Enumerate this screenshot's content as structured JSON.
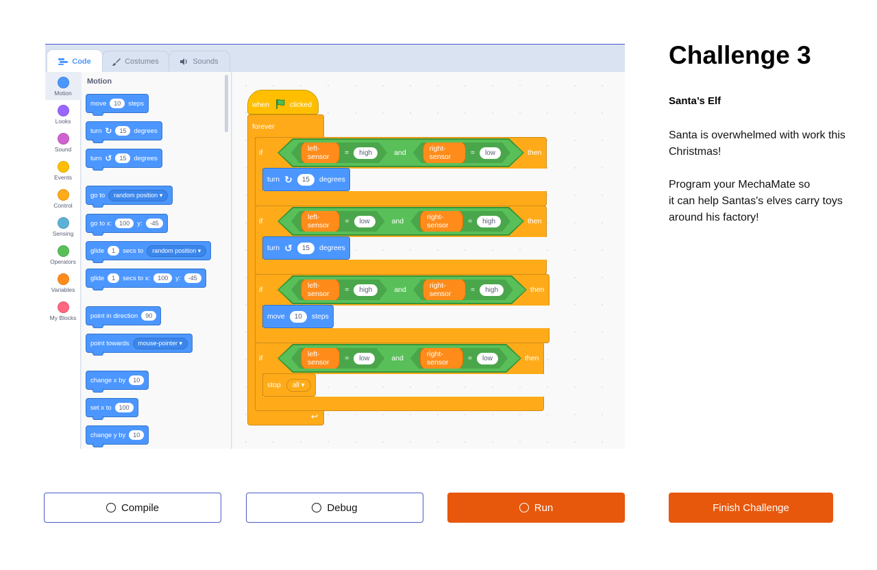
{
  "editor": {
    "tabs": [
      {
        "label": "Code",
        "icon": "code-icon"
      },
      {
        "label": "Costumes",
        "icon": "brush-icon"
      },
      {
        "label": "Sounds",
        "icon": "speaker-icon"
      }
    ],
    "categories": [
      {
        "label": "Motion",
        "color": "#4c97ff"
      },
      {
        "label": "Looks",
        "color": "#9966ff"
      },
      {
        "label": "Sound",
        "color": "#cf63cf"
      },
      {
        "label": "Events",
        "color": "#ffbf00"
      },
      {
        "label": "Control",
        "color": "#ffab19"
      },
      {
        "label": "Sensing",
        "color": "#5cb1d6"
      },
      {
        "label": "Operators",
        "color": "#59c059"
      },
      {
        "label": "Variables",
        "color": "#ff8c1a"
      },
      {
        "label": "My Blocks",
        "color": "#ff6680"
      }
    ],
    "palette": {
      "title": "Motion",
      "move": {
        "a": "move",
        "n": "10",
        "b": "steps"
      },
      "turn_right": {
        "a": "turn",
        "n": "15",
        "b": "degrees"
      },
      "turn_left": {
        "a": "turn",
        "n": "15",
        "b": "degrees"
      },
      "go_to": {
        "a": "go to",
        "dd": "random position"
      },
      "go_to_xy": {
        "a": "go to x:",
        "x": "100",
        "b": "y:",
        "y": "-45"
      },
      "glide_to": {
        "a": "glide",
        "n": "1",
        "b": "secs to",
        "dd": "random position"
      },
      "glide_xy": {
        "a": "glide",
        "n": "1",
        "b": "secs to x:",
        "x": "100",
        "c": "y:",
        "y": "-45"
      },
      "point_dir": {
        "a": "point in direction",
        "n": "90"
      },
      "point_towards": {
        "a": "point towards",
        "dd": "mouse-pointer"
      },
      "change_x": {
        "a": "change x by",
        "n": "10"
      },
      "set_x": {
        "a": "set x to",
        "n": "100"
      },
      "change_y": {
        "a": "change y by",
        "n": "10"
      }
    },
    "script": {
      "hat": {
        "a": "when",
        "b": "clicked"
      },
      "forever": "forever",
      "if_label": "if",
      "then_label": "then",
      "and_label": "and",
      "eq": "=",
      "conditions": [
        {
          "left": "left-sensor",
          "lv": "high",
          "right": "right-sensor",
          "rv": "low"
        },
        {
          "left": "left-sensor",
          "lv": "low",
          "right": "right-sensor",
          "rv": "high"
        },
        {
          "left": "left-sensor",
          "lv": "high",
          "right": "right-sensor",
          "rv": "high"
        },
        {
          "left": "left-sensor",
          "lv": "low",
          "right": "right-sensor",
          "rv": "low"
        }
      ],
      "turn_right": {
        "a": "turn",
        "n": "15",
        "b": "degrees"
      },
      "turn_left": {
        "a": "turn",
        "n": "15",
        "b": "degrees"
      },
      "move": {
        "a": "move",
        "n": "10",
        "b": "steps"
      },
      "stop": {
        "a": "stop",
        "dd": "all"
      }
    }
  },
  "challenge": {
    "title": "Challenge 3",
    "subtitle": "Santa’s Elf",
    "paragraph1": "Santa is overwhelmed with work this Christmas!",
    "paragraph2_line1": "Program your MechaMate so",
    "paragraph2_line2": "it can help Santas's elves carry toys around his factory!"
  },
  "buttons": {
    "compile": "Compile",
    "debug": "Debug",
    "run": "Run",
    "finish": "Finish Challenge"
  },
  "colors": {
    "accent": "#e8580c",
    "outline": "#4a58c6",
    "motion": "#4c97ff",
    "control": "#ffab19",
    "events": "#ffbf00",
    "operators": "#59c059",
    "variables": "#ff8c1a"
  }
}
